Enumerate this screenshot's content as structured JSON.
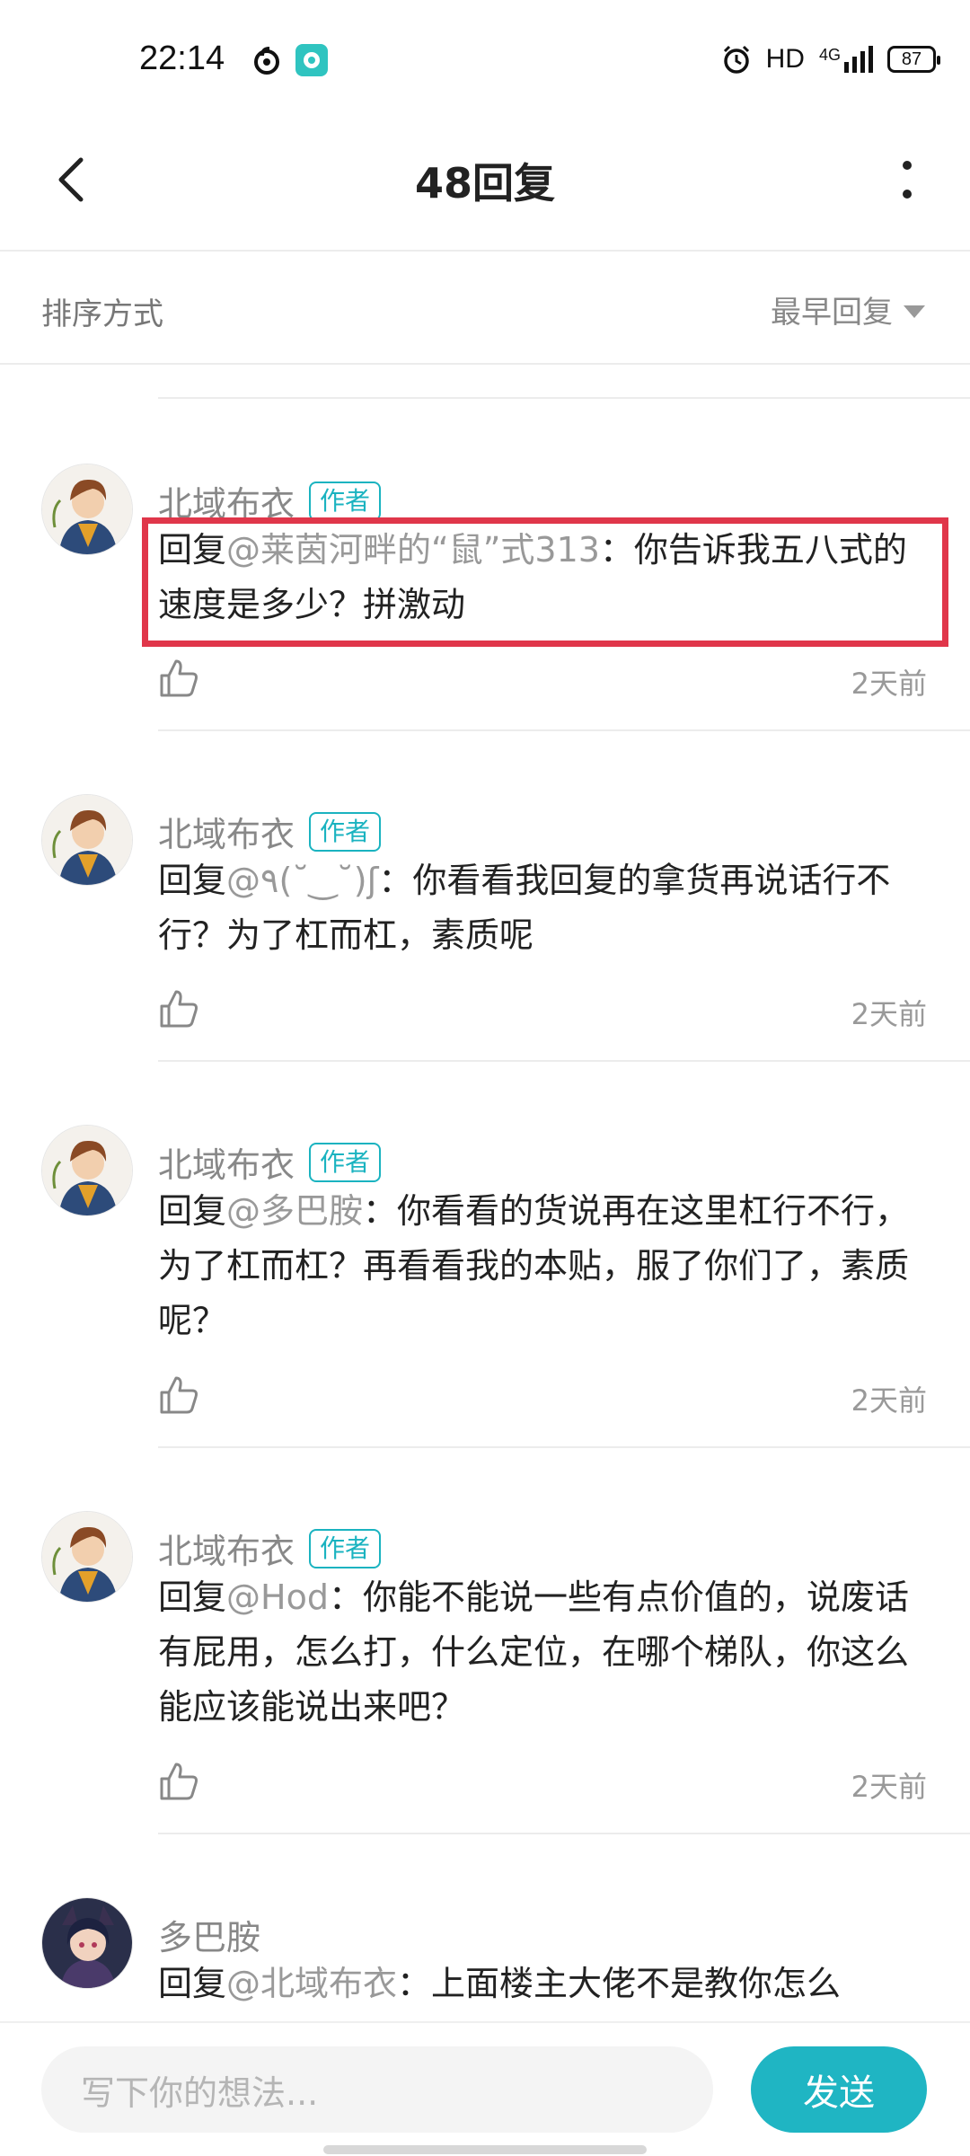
{
  "status_bar": {
    "time": "22:14",
    "hd": "HD",
    "network": "4G",
    "battery": "87",
    "icons": [
      "netease-music-icon",
      "app-notification-icon",
      "alarm-icon",
      "signal-icon",
      "battery-icon"
    ]
  },
  "header": {
    "title": "48回复",
    "back_icon": "chevron-left-icon",
    "more_icon": "more-vertical-icon"
  },
  "sort": {
    "label": "排序方式",
    "selected": "最早回复"
  },
  "comments": [
    {
      "name": "北域布衣",
      "badge": "作者",
      "prefix": "回复",
      "mention": "@莱茵河畔的“鼠”式313",
      "text": "：你告诉我五八式的速度是多少？拼激动",
      "time": "2天前",
      "highlighted": true
    },
    {
      "name": "北域布衣",
      "badge": "作者",
      "prefix": "回复",
      "mention": "@٩(˘‿˘)ʃ",
      "text": "：你看看我回复的拿货再说话行不行？为了杠而杠，素质呢",
      "time": "2天前"
    },
    {
      "name": "北域布衣",
      "badge": "作者",
      "prefix": "回复",
      "mention": "@多巴胺",
      "text": "：你看看的货说再在这里杠行不行，为了杠而杠？再看看我的本贴，服了你们了，素质呢？",
      "time": "2天前"
    },
    {
      "name": "北域布衣",
      "badge": "作者",
      "prefix": "回复",
      "mention": "@Hod",
      "text": "：你能不能说一些有点价值的，说废话有屁用，怎么打，什么定位，在哪个梯队，你这么能应该能说出来吧？",
      "time": "2天前"
    },
    {
      "name": "多巴胺",
      "prefix": "回复",
      "mention": "@北域布衣",
      "text": "：上面楼主大佬不是教你怎么"
    }
  ],
  "input": {
    "placeholder": "写下你的想法...",
    "send_label": "发送"
  },
  "colors": {
    "accent": "#1fb5c3",
    "highlight": "#e0364a"
  }
}
